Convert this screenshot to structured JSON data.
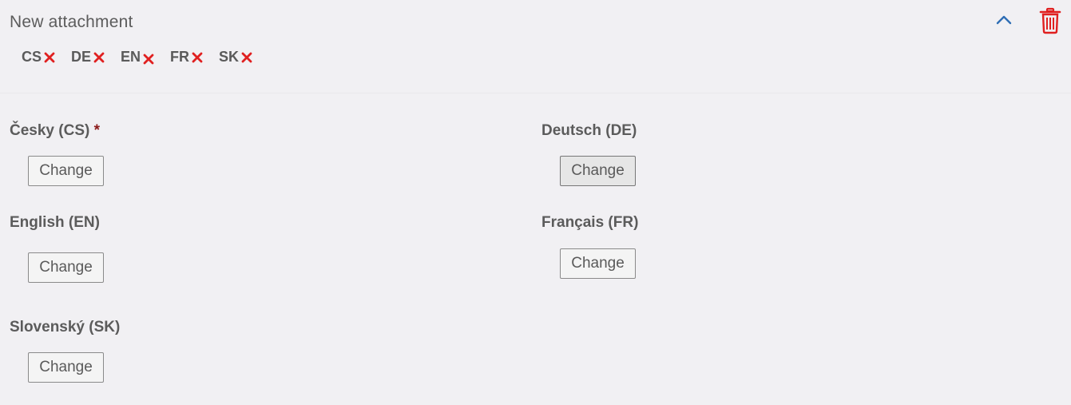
{
  "panel": {
    "title": "New attachment",
    "collapse_icon": "chevron-up-icon",
    "delete_icon": "trash-icon",
    "accent_color": "#2f6eb5",
    "danger_color": "#e02020"
  },
  "languages": [
    {
      "code": "CS"
    },
    {
      "code": "DE"
    },
    {
      "code": "EN"
    },
    {
      "code": "FR"
    },
    {
      "code": "SK"
    }
  ],
  "fields": [
    {
      "label": "Česky (CS)",
      "required": "*",
      "button": "Change"
    },
    {
      "label": "Deutsch (DE)",
      "button": "Change"
    },
    {
      "label": "English (EN)",
      "button": "Change"
    },
    {
      "label": "Français (FR)",
      "button": "Change"
    },
    {
      "label": "Slovenský (SK)",
      "button": "Change"
    }
  ]
}
